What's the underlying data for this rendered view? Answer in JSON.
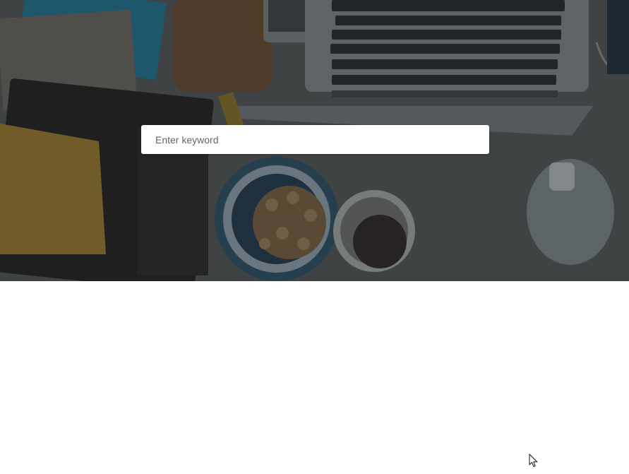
{
  "hero": {
    "background_image": "desk-workspace-photo",
    "overlay_color": "#1f2a30"
  },
  "search": {
    "placeholder": "Enter keyword",
    "value": ""
  },
  "colors": {
    "page_background": "#ffffff",
    "input_background": "#ffffff",
    "placeholder_text": "#666666"
  },
  "icons": {
    "pointer": "mouse-pointer-icon"
  }
}
